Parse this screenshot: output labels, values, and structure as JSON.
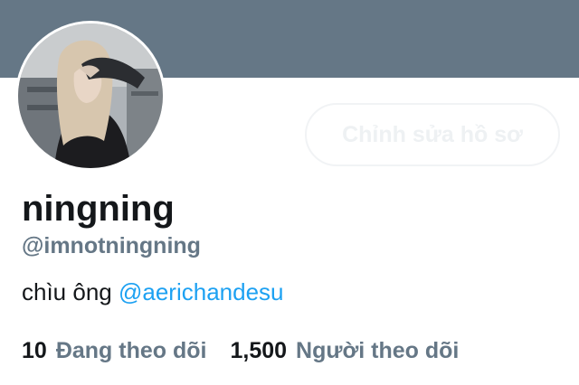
{
  "profile": {
    "display_name": "ningning",
    "handle": "@imnotningning",
    "bio_text": "chìu ông ",
    "bio_mention": "@aerichandesu",
    "edit_button_label": "Chỉnh sửa hồ sơ"
  },
  "stats": {
    "following_count": "10",
    "following_label": "Đang theo dõi",
    "followers_count": "1,500",
    "followers_label": "Người theo dõi"
  },
  "colors": {
    "banner": "#657786",
    "mention": "#1da1f2",
    "secondary_text": "#657786",
    "primary_text": "#14171a"
  }
}
